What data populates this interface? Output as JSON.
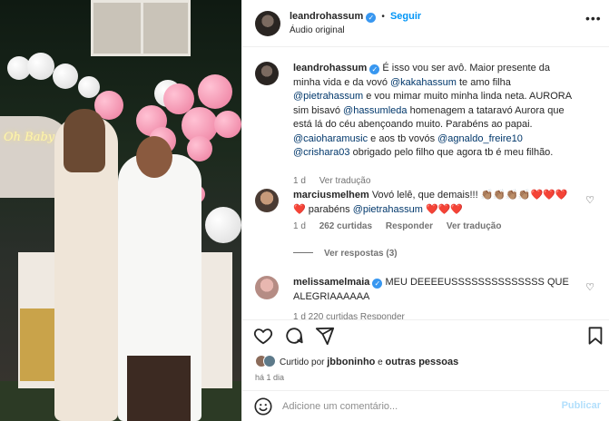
{
  "colors": {
    "link": "#00376b",
    "follow": "#0095f6",
    "verified": "#3897f0",
    "muted": "#737373"
  },
  "photo": {
    "neon_text": "Oh Baby"
  },
  "header": {
    "username": "leandrohassum",
    "follow_label": "Seguir",
    "separator": "•",
    "audio": "Áudio original"
  },
  "caption": {
    "username": "leandrohassum",
    "parts": {
      "p1": "É isso vou ser avô. Maior presente da minha vida e da vovó ",
      "m1": "@kakahassum",
      "p2": " te amo filha ",
      "m2": "@pietrahassum",
      "p3": " e vou mimar muito minha linda neta. AURORA sim bisavó ",
      "m3": "@hassumleda",
      "p4": " homenagem a tataravó Aurora que está lá do céu abençoando muito. Parabéns ao papai. ",
      "m4": "@caioharamusic",
      "p5": " e aos tb vovós ",
      "m5": "@agnaldo_freire10",
      "p6": " ",
      "m6": "@crishara03",
      "p7": " obrigado pelo filho que agora tb é meu filhão."
    },
    "time": "1 d",
    "translate": "Ver tradução"
  },
  "comments": [
    {
      "username": "marciusmelhem",
      "text": "Vovó lelê, que demais!!! 👏🏽👏🏽👏🏽👏🏽❤️❤️❤️ ❤️ parabéns ",
      "mention": "@pietrahassum",
      "tail": " ❤️❤️❤️",
      "time": "1 d",
      "likes": "262 curtidas",
      "reply": "Responder",
      "translate": "Ver tradução",
      "view_replies": "Ver respostas (3)"
    },
    {
      "username": "melissamelmaia",
      "verified": true,
      "text": " MEU DEEEEUSSSSSSSSSSSSSS QUE ALEGRIAAAAAA",
      "meta_partial": "1 d   220 curtidas   Responder"
    }
  ],
  "actions": {
    "icons": [
      "heart-icon",
      "comment-icon",
      "share-icon",
      "bookmark-icon"
    ],
    "liked_by_prefix": "Curtido por ",
    "liked_by_user": "jbboninho",
    "liked_by_suffix": " e ",
    "liked_by_others": "outras pessoas",
    "date": "há 1 dia"
  },
  "comment_bar": {
    "placeholder": "Adicione um comentário...",
    "publish_label": "Publicar",
    "icon": "emoji-icon"
  }
}
